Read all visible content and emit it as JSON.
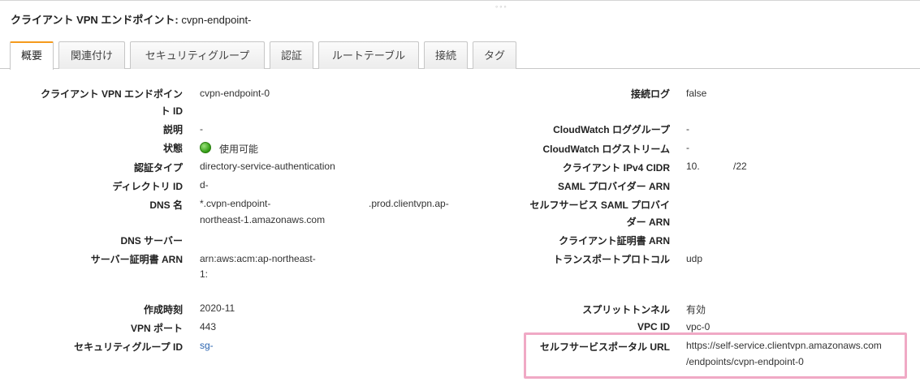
{
  "header": {
    "title_label": "クライアント VPN エンドポイント:",
    "title_value": "cvpn-endpoint-",
    "drag_handle": "◦◦◦"
  },
  "tabs": [
    {
      "label": "概要",
      "active": true
    },
    {
      "label": "関連付け"
    },
    {
      "label": "セキュリティグループ"
    },
    {
      "label": "認証"
    },
    {
      "label": "ルートテーブル"
    },
    {
      "label": "接続"
    },
    {
      "label": "タグ"
    }
  ],
  "left": {
    "endpoint_id_label_1": "クライアント VPN エンドポイン",
    "endpoint_id_label_2": "ト ID",
    "endpoint_id_value": "cvpn-endpoint-0",
    "description_label": "説明",
    "description_value": "-",
    "state_label": "状態",
    "state_value": "使用可能",
    "auth_type_label": "認証タイプ",
    "auth_type_value": "directory-service-authentication",
    "directory_id_label": "ディレクトリ ID",
    "directory_id_value": "d-",
    "dns_name_label": "DNS 名",
    "dns_name_value_1a": "*.cvpn-endpoint-",
    "dns_name_value_1b": ".prod.clientvpn.ap-",
    "dns_name_value_2": "northeast-1.amazonaws.com",
    "dns_server_label": "DNS サーバー",
    "server_cert_label": "サーバー証明書 ARN",
    "server_cert_value_1": "arn:aws:acm:ap-northeast-",
    "server_cert_value_2": "1:",
    "created_label": "作成時刻",
    "created_value": "2020-11",
    "vpn_port_label": "VPN ポート",
    "vpn_port_value": "443",
    "sg_id_label": "セキュリティグループ ID",
    "sg_id_value": "sg-"
  },
  "right": {
    "conn_log_label": "接続ログ",
    "conn_log_value": "false",
    "cw_log_group_label": "CloudWatch ロググループ",
    "cw_log_group_value": "-",
    "cw_log_stream_label": "CloudWatch ログストリーム",
    "cw_log_stream_value": "-",
    "client_cidr_label": "クライアント IPv4 CIDR",
    "client_cidr_value_a": "10.",
    "client_cidr_value_b": "/22",
    "saml_provider_label": "SAML プロバイダー ARN",
    "self_saml_label_1": "セルフサービス SAML プロバイ",
    "self_saml_label_2": "ダー ARN",
    "client_cert_label": "クライアント証明書 ARN",
    "transport_label": "トランスポートプロトコル",
    "transport_value": "udp",
    "split_tunnel_label": "スプリットトンネル",
    "split_tunnel_value": "有効",
    "vpc_id_label": "VPC ID",
    "vpc_id_value": "vpc-0",
    "portal_url_label": "セルフサービスポータル URL",
    "portal_url_value_1": "https://self-service.clientvpn.amazonaws.com",
    "portal_url_value_2": "/endpoints/cvpn-endpoint-0"
  },
  "colors": {
    "active_tab_accent": "#f59a1c",
    "highlight_border": "#f0a9c5",
    "link": "#2a64b0",
    "status_available": "#2f9a12"
  }
}
